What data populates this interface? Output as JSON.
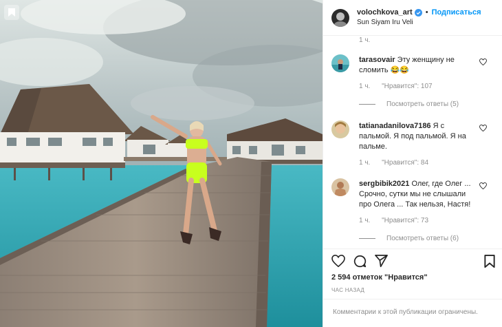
{
  "post": {
    "username": "volochkova_art",
    "separator": "•",
    "follow_label": "Подписаться",
    "location": "Sun Siyam Iru Veli",
    "top_timestamp": "1 ч."
  },
  "comments": [
    {
      "username": "tarasovair",
      "text": "Эту женщину не сломить 😂😂",
      "time": "1 ч.",
      "likes": "\"Нравится\": 107",
      "replies": "Посмотреть ответы (5)"
    },
    {
      "username": "tatianadanilova7186",
      "text": "Я с пальмой. Я под пальмой. Я на пальме.",
      "time": "1 ч.",
      "likes": "\"Нравится\": 84",
      "replies": ""
    },
    {
      "username": "sergbibik2021",
      "text": "Олег, где Олег ... Срочно, сутки мы не слышали про Олега ... Так нельзя, Настя!",
      "time": "1 ч.",
      "likes": "\"Нравится\": 73",
      "replies": "Посмотреть ответы (6)"
    }
  ],
  "actions": {
    "like_icon": "heart-icon",
    "comment_icon": "comment-icon",
    "share_icon": "paper-plane-icon",
    "save_icon": "bookmark-icon"
  },
  "likes_text": "2 594 отметок \"Нравится\"",
  "time_ago": "ЧАС НАЗАД",
  "comments_limited": "Комментарии к этой публикации ограничены.",
  "colors": {
    "accent": "#0095f6",
    "text": "#262626",
    "muted": "#8e8e8e",
    "border": "#efefef",
    "swimsuit": "#c8ff1e"
  }
}
